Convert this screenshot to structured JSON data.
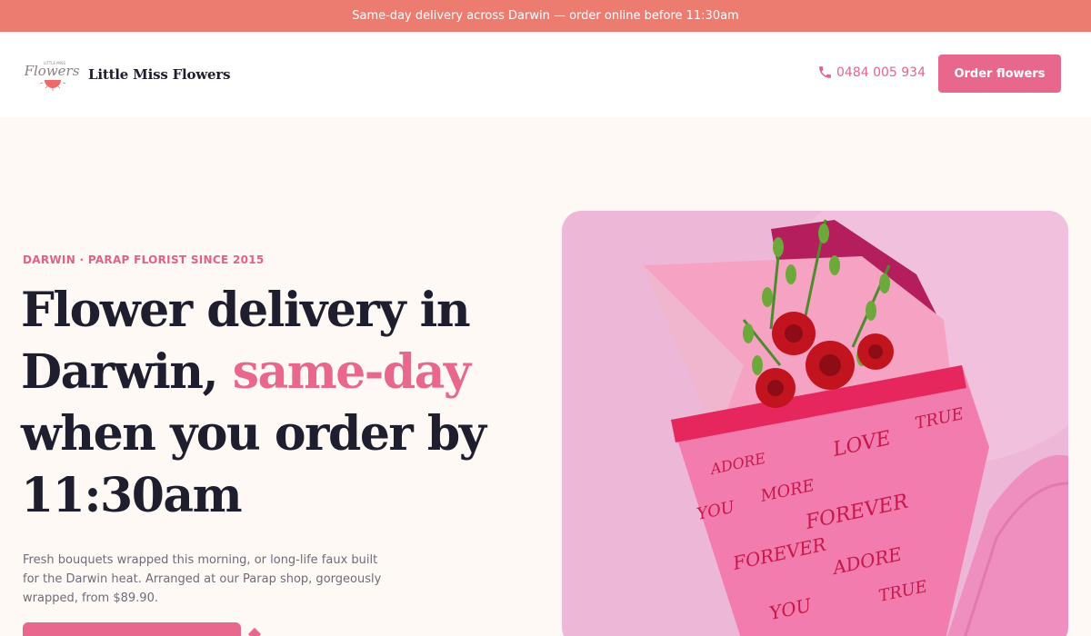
{
  "announcement": "Same-day delivery across Darwin — order online before 11:30am",
  "header": {
    "brand": "Little Miss Flowers",
    "logo_script": "Flowers",
    "logo_small": "LITTLE MISS",
    "phone": "0484 005 934",
    "order_button": "Order flowers"
  },
  "hero": {
    "eyebrow": "DARWIN · PARAP FLORIST SINCE 2015",
    "headline_part1": "Flower delivery in Darwin, ",
    "headline_accent": "same-day",
    "headline_part2": " when you order by 11:30am",
    "lede": "Fresh bouquets wrapped this morning, or long-life faux built for the Darwin heat. Arranged at our Parap shop, gorgeously wrapped, from $89.90.",
    "image_alt_words": [
      "ADORE",
      "LOVE",
      "TRUE",
      "FOREVER",
      "YOU",
      "MORE"
    ]
  },
  "colors": {
    "announcement_bg": "#ec7b70",
    "brand_pink": "#e8678c",
    "ink": "#1f1e2e",
    "cream": "#fef9f5"
  }
}
